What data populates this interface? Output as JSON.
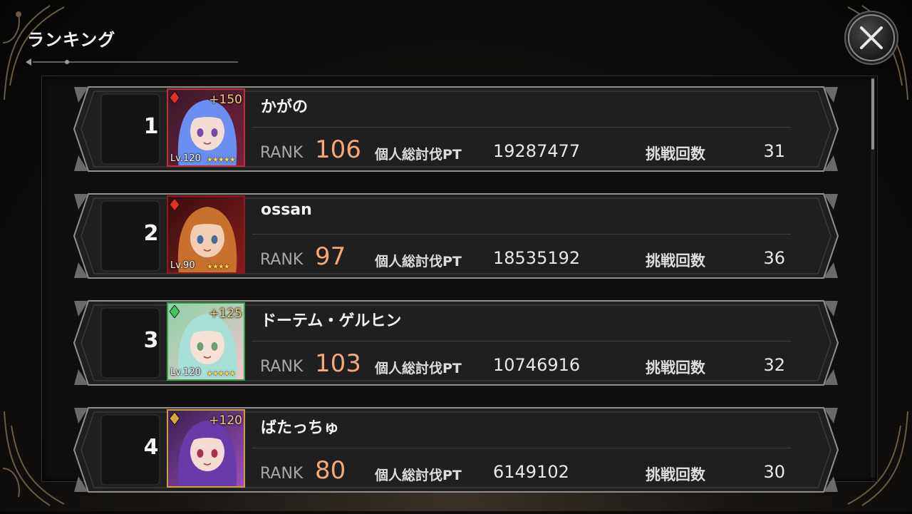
{
  "header": {
    "title": "ランキング"
  },
  "labels": {
    "rank": "RANK",
    "points": "個人総討伐PT",
    "challenges": "挑戦回数"
  },
  "colors": {
    "accent_rank": "#f4a878",
    "background": "#0f0f0f"
  },
  "ranking": [
    {
      "position": "1",
      "name": "かがの",
      "rank": "106",
      "points": "19287477",
      "challenges": "31",
      "avatar": {
        "bonus": "+150",
        "level": "Lv.120",
        "stars": "★★★★★",
        "element": "fire",
        "portrait": "blue-haired-girl"
      }
    },
    {
      "position": "2",
      "name": "ossan",
      "rank": "97",
      "points": "18535192",
      "challenges": "36",
      "avatar": {
        "bonus": "",
        "level": "Lv.90",
        "stars": "★★★★",
        "element": "fire",
        "portrait": "orange-haired-maid"
      }
    },
    {
      "position": "3",
      "name": "ドーテム・ゲルヒン",
      "rank": "103",
      "points": "10746916",
      "challenges": "32",
      "avatar": {
        "bonus": "+125",
        "level": "Lv.120",
        "stars": "★★★★★",
        "element": "wind",
        "portrait": "twin-girls"
      }
    },
    {
      "position": "4",
      "name": "ばたっちゅ",
      "rank": "80",
      "points": "6149102",
      "challenges": "30",
      "avatar": {
        "bonus": "+120",
        "level": "",
        "stars": "",
        "element": "earth",
        "portrait": "purple-haired-girl"
      }
    }
  ]
}
